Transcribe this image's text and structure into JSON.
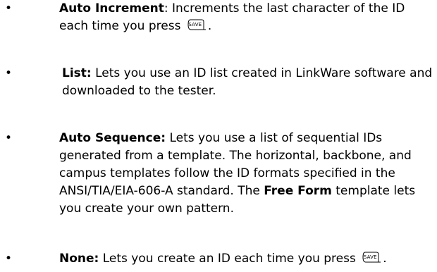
{
  "items": [
    {
      "term": "Auto Increment",
      "desc_before": ": Increments the last character of the ID each time you press ",
      "key": "SAVE",
      "desc_after": "."
    },
    {
      "term": "List:",
      "desc": " Lets you use an ID list created in LinkWare software and downloaded to the tester."
    },
    {
      "term": "Auto Sequence:",
      "desc_before": " Lets you use a list of sequential IDs generated from a template. The horizontal, backbone, and campus templates follow the ID formats specified in the ANSI/TIA/EIA-606-A standard. The ",
      "inline_term": "Free Form",
      "desc_after": " template lets you create your own pattern."
    },
    {
      "term": "None:",
      "desc_before": " Lets you create an ID each time you press ",
      "key": "SAVE",
      "desc_after": "."
    }
  ],
  "bullet_glyph": "•",
  "key_icon": "save-key-icon"
}
